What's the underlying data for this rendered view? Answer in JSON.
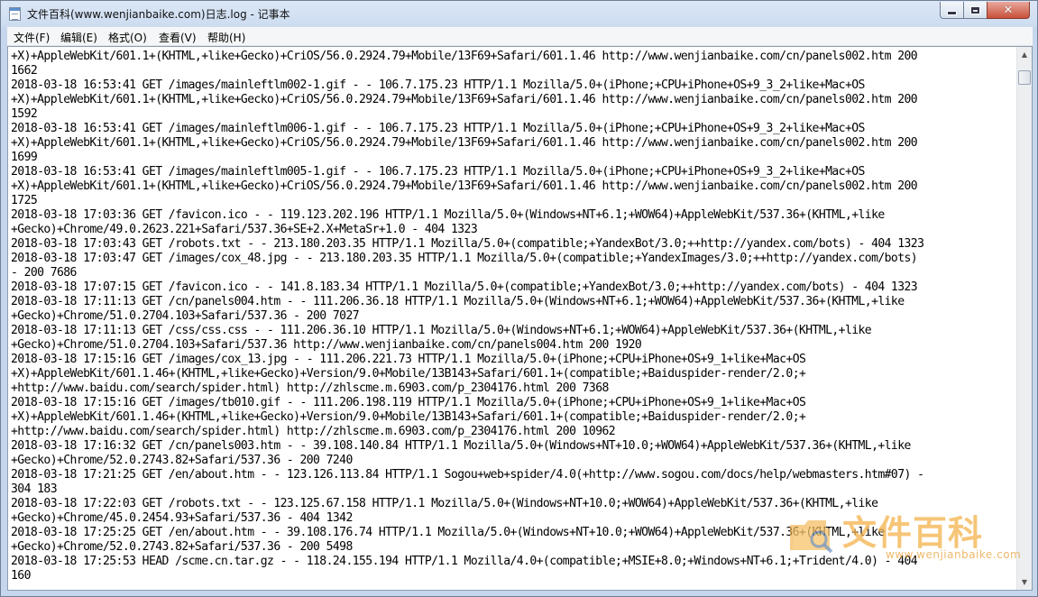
{
  "window": {
    "title": "文件百科(www.wenjianbaike.com)日志.log - 记事本",
    "controls": {
      "minimize": "minimize-icon",
      "maximize": "maximize-icon",
      "close": "close-icon"
    }
  },
  "menu": {
    "items": [
      {
        "label": "文件(F)"
      },
      {
        "label": "编辑(E)"
      },
      {
        "label": "格式(O)"
      },
      {
        "label": "查看(V)"
      },
      {
        "label": "帮助(H)"
      }
    ]
  },
  "editor": {
    "lines": [
      "+X)+AppleWebKit/601.1+(KHTML,+like+Gecko)+CriOS/56.0.2924.79+Mobile/13F69+Safari/601.1.46 http://www.wenjianbaike.com/cn/panels002.htm 200",
      "1662",
      "2018-03-18 16:53:41 GET /images/mainleftlm002-1.gif - - 106.7.175.23 HTTP/1.1 Mozilla/5.0+(iPhone;+CPU+iPhone+OS+9_3_2+like+Mac+OS",
      "+X)+AppleWebKit/601.1+(KHTML,+like+Gecko)+CriOS/56.0.2924.79+Mobile/13F69+Safari/601.1.46 http://www.wenjianbaike.com/cn/panels002.htm 200",
      "1592",
      "2018-03-18 16:53:41 GET /images/mainleftlm006-1.gif - - 106.7.175.23 HTTP/1.1 Mozilla/5.0+(iPhone;+CPU+iPhone+OS+9_3_2+like+Mac+OS",
      "+X)+AppleWebKit/601.1+(KHTML,+like+Gecko)+CriOS/56.0.2924.79+Mobile/13F69+Safari/601.1.46 http://www.wenjianbaike.com/cn/panels002.htm 200",
      "1699",
      "2018-03-18 16:53:41 GET /images/mainleftlm005-1.gif - - 106.7.175.23 HTTP/1.1 Mozilla/5.0+(iPhone;+CPU+iPhone+OS+9_3_2+like+Mac+OS",
      "+X)+AppleWebKit/601.1+(KHTML,+like+Gecko)+CriOS/56.0.2924.79+Mobile/13F69+Safari/601.1.46 http://www.wenjianbaike.com/cn/panels002.htm 200",
      "1725",
      "2018-03-18 17:03:36 GET /favicon.ico - - 119.123.202.196 HTTP/1.1 Mozilla/5.0+(Windows+NT+6.1;+WOW64)+AppleWebKit/537.36+(KHTML,+like",
      "+Gecko)+Chrome/49.0.2623.221+Safari/537.36+SE+2.X+MetaSr+1.0 - 404 1323",
      "2018-03-18 17:03:43 GET /robots.txt - - 213.180.203.35 HTTP/1.1 Mozilla/5.0+(compatible;+YandexBot/3.0;++http://yandex.com/bots) - 404 1323",
      "2018-03-18 17:03:47 GET /images/cox_48.jpg - - 213.180.203.35 HTTP/1.1 Mozilla/5.0+(compatible;+YandexImages/3.0;++http://yandex.com/bots)",
      "- 200 7686",
      "2018-03-18 17:07:15 GET /favicon.ico - - 141.8.183.34 HTTP/1.1 Mozilla/5.0+(compatible;+YandexBot/3.0;++http://yandex.com/bots) - 404 1323",
      "2018-03-18 17:11:13 GET /cn/panels004.htm - - 111.206.36.18 HTTP/1.1 Mozilla/5.0+(Windows+NT+6.1;+WOW64)+AppleWebKit/537.36+(KHTML,+like",
      "+Gecko)+Chrome/51.0.2704.103+Safari/537.36 - 200 7027",
      "2018-03-18 17:11:13 GET /css/css.css - - 111.206.36.10 HTTP/1.1 Mozilla/5.0+(Windows+NT+6.1;+WOW64)+AppleWebKit/537.36+(KHTML,+like",
      "+Gecko)+Chrome/51.0.2704.103+Safari/537.36 http://www.wenjianbaike.com/cn/panels004.htm 200 1920",
      "2018-03-18 17:15:16 GET /images/cox_13.jpg - - 111.206.221.73 HTTP/1.1 Mozilla/5.0+(iPhone;+CPU+iPhone+OS+9_1+like+Mac+OS",
      "+X)+AppleWebKit/601.1.46+(KHTML,+like+Gecko)+Version/9.0+Mobile/13B143+Safari/601.1+(compatible;+Baiduspider-render/2.0;+",
      "+http://www.baidu.com/search/spider.html) http://zhlscme.m.6903.com/p_2304176.html 200 7368",
      "2018-03-18 17:15:16 GET /images/tb010.gif - - 111.206.198.119 HTTP/1.1 Mozilla/5.0+(iPhone;+CPU+iPhone+OS+9_1+like+Mac+OS",
      "+X)+AppleWebKit/601.1.46+(KHTML,+like+Gecko)+Version/9.0+Mobile/13B143+Safari/601.1+(compatible;+Baiduspider-render/2.0;+",
      "+http://www.baidu.com/search/spider.html) http://zhlscme.m.6903.com/p_2304176.html 200 10962",
      "2018-03-18 17:16:32 GET /cn/panels003.htm - - 39.108.140.84 HTTP/1.1 Mozilla/5.0+(Windows+NT+10.0;+WOW64)+AppleWebKit/537.36+(KHTML,+like",
      "+Gecko)+Chrome/52.0.2743.82+Safari/537.36 - 200 7240",
      "2018-03-18 17:21:25 GET /en/about.htm - - 123.126.113.84 HTTP/1.1 Sogou+web+spider/4.0(+http://www.sogou.com/docs/help/webmasters.htm#07) -",
      "304 183",
      "2018-03-18 17:22:03 GET /robots.txt - - 123.125.67.158 HTTP/1.1 Mozilla/5.0+(Windows+NT+10.0;+WOW64)+AppleWebKit/537.36+(KHTML,+like",
      "+Gecko)+Chrome/45.0.2454.93+Safari/537.36 - 404 1342",
      "2018-03-18 17:25:25 GET /en/about.htm - - 39.108.176.74 HTTP/1.1 Mozilla/5.0+(Windows+NT+10.0;+WOW64)+AppleWebKit/537.36+(KHTML,+like",
      "+Gecko)+Chrome/52.0.2743.82+Safari/537.36 - 200 5498",
      "2018-03-18 17:25:53 HEAD /scme.cn.tar.gz - - 118.24.155.194 HTTP/1.1 Mozilla/4.0+(compatible;+MSIE+8.0;+Windows+NT+6.1;+Trident/4.0) - 404",
      "160"
    ]
  },
  "scrollbar": {
    "up": "scroll-up-arrow-icon",
    "down": "scroll-down-arrow-icon"
  },
  "watermark": {
    "brand": "文件百科",
    "url": "www.wenjianbaike.com",
    "logo_icon": "folder-magnifier-logo-icon",
    "color": "#f3b24a"
  }
}
